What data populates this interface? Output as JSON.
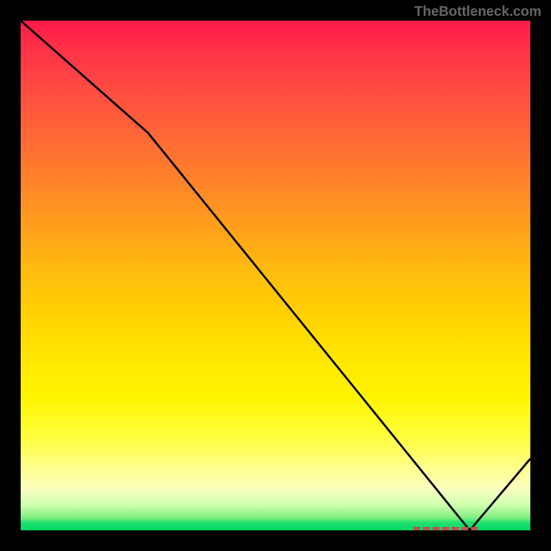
{
  "attribution": "TheBottleneck.com",
  "chart_data": {
    "type": "line",
    "title": "",
    "xlabel": "",
    "ylabel": "",
    "ylim": [
      0,
      100
    ],
    "x": [
      0,
      25,
      88,
      100
    ],
    "values": [
      100,
      78,
      0,
      14
    ],
    "marker_range_x": [
      77,
      90
    ],
    "note": "Bottleneck-style curve: line descends from top-left, dips to zero near x≈85, then rises; red dashed marker band indicates optimal range on the x-axis at y=0."
  }
}
